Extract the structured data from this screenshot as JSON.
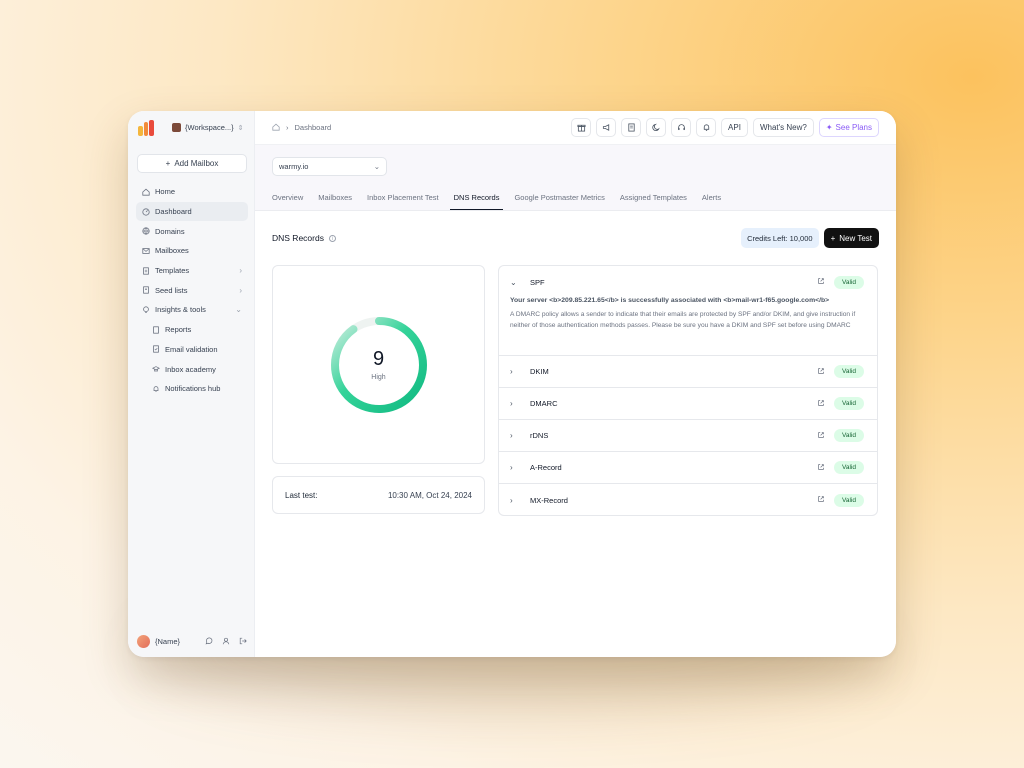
{
  "colors": {
    "accent": "#111111",
    "valid_bg": "#dcfce7",
    "valid_text": "#166534",
    "ring_green": "#1fc48a",
    "ring_track": "#eef3f1",
    "plans": "#8b5cf6"
  },
  "sidebar": {
    "workspace": "{Workspace...}",
    "add_mailbox": "Add Mailbox",
    "items": [
      {
        "label": "Home",
        "icon": "home-icon"
      },
      {
        "label": "Dashboard",
        "icon": "dashboard-icon"
      },
      {
        "label": "Domains",
        "icon": "globe-icon"
      },
      {
        "label": "Mailboxes",
        "icon": "mail-icon"
      },
      {
        "label": "Templates",
        "icon": "template-icon"
      },
      {
        "label": "Seed lists",
        "icon": "list-icon"
      },
      {
        "label": "Insights & tools",
        "icon": "bulb-icon"
      },
      {
        "label": "Reports",
        "icon": "report-icon"
      },
      {
        "label": "Email validation",
        "icon": "check-doc-icon"
      },
      {
        "label": "Inbox academy",
        "icon": "academy-icon"
      },
      {
        "label": "Notifications hub",
        "icon": "bell-icon"
      }
    ],
    "user_name": "{Name}"
  },
  "topbar": {
    "breadcrumb": "Dashboard",
    "api": "API",
    "whats_new": "What's New?",
    "see_plans": "See Plans"
  },
  "domain_select": "warmy.io",
  "tabs": [
    "Overview",
    "Mailboxes",
    "Inbox Placement Test",
    "DNS Records",
    "Google Postmaster Metrics",
    "Assigned Templates",
    "Alerts"
  ],
  "section": {
    "title": "DNS Records",
    "credits": "Credits Left: 10,000",
    "new_test": "New Test"
  },
  "score": {
    "value": "9",
    "label": "High",
    "fraction": 0.9
  },
  "last_test": {
    "label": "Last test:",
    "value": "10:30 AM, Oct 24, 2024"
  },
  "records": [
    {
      "name": "SPF",
      "status": "Valid",
      "expanded": true,
      "message": "Your server <b>209.85.221.65</b> is successfully associated with <b>mail-wr1-f65.google.com</b>",
      "description": "A DMARC policy allows a sender to indicate that their emails are protected by SPF and/or DKIM, and give instruction if neither of those authentication methods passes. Please be sure you have a DKIM and SPF set before using DMARC"
    },
    {
      "name": "DKIM",
      "status": "Valid"
    },
    {
      "name": "DMARC",
      "status": "Valid"
    },
    {
      "name": "rDNS",
      "status": "Valid"
    },
    {
      "name": "A-Record",
      "status": "Valid"
    },
    {
      "name": "MX-Record",
      "status": "Valid"
    }
  ]
}
